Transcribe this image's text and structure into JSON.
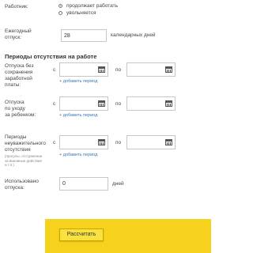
{
  "worker": {
    "label": "Работник:",
    "options": [
      {
        "label": "продолжает работать",
        "selected": true
      },
      {
        "label": "увольняется",
        "selected": false
      }
    ]
  },
  "annual_leave": {
    "label": "Ежегодный\nотпуск:",
    "value": "28",
    "unit": "календарных дней"
  },
  "absence": {
    "title": "Периоды отсутствия на работе",
    "from_label": "с",
    "to_label": "по",
    "add_link": "+ добавить период",
    "rows": [
      {
        "label": "Отпуска без\nсохранения\nзаработной\nплаты:",
        "note": ""
      },
      {
        "label": "Отпуска\nпо уходу\nза ребенком:",
        "note": ""
      },
      {
        "label": "Периоды\nнеуважительного\nотсутствия",
        "note": "(прогулы, отстранение\nза виновные действия\nи т.п.)"
      }
    ]
  },
  "used_leave": {
    "label": "Использовано\nотпуска:",
    "value": "0",
    "unit": "дней"
  },
  "calculate": {
    "label": "Рассчитать"
  }
}
